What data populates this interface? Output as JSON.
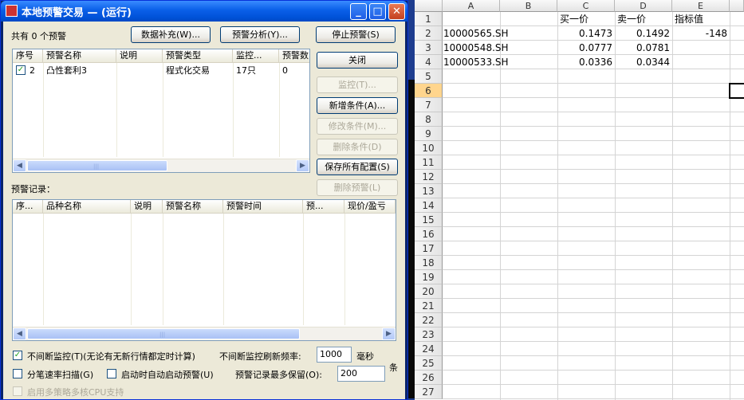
{
  "window": {
    "title": "本地预警交易  — (运行)",
    "min_glyph": "_",
    "max_glyph": "□",
    "close_glyph": "✕"
  },
  "summary": {
    "count_text": "共有 0 个预警",
    "data_supplement_btn": "数据补充(W)...",
    "analysis_btn": "预警分析(Y)...",
    "stop_btn": "停止预警(S)"
  },
  "buttons": {
    "close": "关闭",
    "monitor": "监控(T)...",
    "add_condition": "新增条件(A)...",
    "modify_condition": "修改条件(M)...",
    "delete_condition": "删除条件(D)",
    "save_all": "保存所有配置(S)",
    "delete_alert": "删除预警(L)"
  },
  "conditions_table": {
    "headers": [
      "序号",
      "预警名称",
      "说明",
      "预警类型",
      "监控...",
      "预警数"
    ],
    "rows": [
      {
        "checked": true,
        "index": "2",
        "name": "凸性套利3",
        "desc": "",
        "type": "程式化交易",
        "monitor": "17只",
        "count": "0"
      }
    ]
  },
  "records": {
    "label": "预警记录：",
    "headers": [
      "序...",
      "品种名称",
      "说明",
      "预警名称",
      "预警时间",
      "预...",
      "现价/盈亏"
    ]
  },
  "options": {
    "continuous_monitor": "不间断监控(T)(无论有无新行情都定时计算)",
    "continuous_checked": true,
    "refresh_label": "不间断监控刷新频率:",
    "refresh_value": "1000",
    "refresh_unit": "毫秒",
    "tick_scan": "分笔速率扫描(G)",
    "tick_scan_checked": false,
    "auto_start": "启动时自动启动预警(U)",
    "auto_start_checked": false,
    "max_records_label": "预警记录最多保留(O):",
    "max_records_value": "200",
    "max_records_unit": "条",
    "multicore": "启用多策略多核CPU支持",
    "multicore_checked": false
  },
  "sheet": {
    "columns": [
      "A",
      "B",
      "C",
      "D",
      "E"
    ],
    "selected_row": "6",
    "rows": [
      {
        "n": "1",
        "A": "",
        "B": "",
        "C": "买一价",
        "D": "卖一价",
        "E": "指标值"
      },
      {
        "n": "2",
        "A": "10000565.SH",
        "B": "",
        "C": "0.1473",
        "D": "0.1492",
        "E": "-148"
      },
      {
        "n": "3",
        "A": "10000548.SH",
        "B": "",
        "C": "0.0777",
        "D": "0.0781",
        "E": ""
      },
      {
        "n": "4",
        "A": "10000533.SH",
        "B": "",
        "C": "0.0336",
        "D": "0.0344",
        "E": ""
      },
      {
        "n": "5",
        "A": "",
        "B": "",
        "C": "",
        "D": "",
        "E": ""
      },
      {
        "n": "6",
        "A": "",
        "B": "",
        "C": "",
        "D": "",
        "E": ""
      },
      {
        "n": "7"
      },
      {
        "n": "8"
      },
      {
        "n": "9"
      },
      {
        "n": "10"
      },
      {
        "n": "11"
      },
      {
        "n": "12"
      },
      {
        "n": "13"
      },
      {
        "n": "14"
      },
      {
        "n": "15"
      },
      {
        "n": "16"
      },
      {
        "n": "17"
      },
      {
        "n": "18"
      },
      {
        "n": "19"
      },
      {
        "n": "20"
      },
      {
        "n": "21"
      },
      {
        "n": "22"
      },
      {
        "n": "23"
      },
      {
        "n": "24"
      },
      {
        "n": "25"
      },
      {
        "n": "26"
      },
      {
        "n": "27"
      }
    ]
  }
}
